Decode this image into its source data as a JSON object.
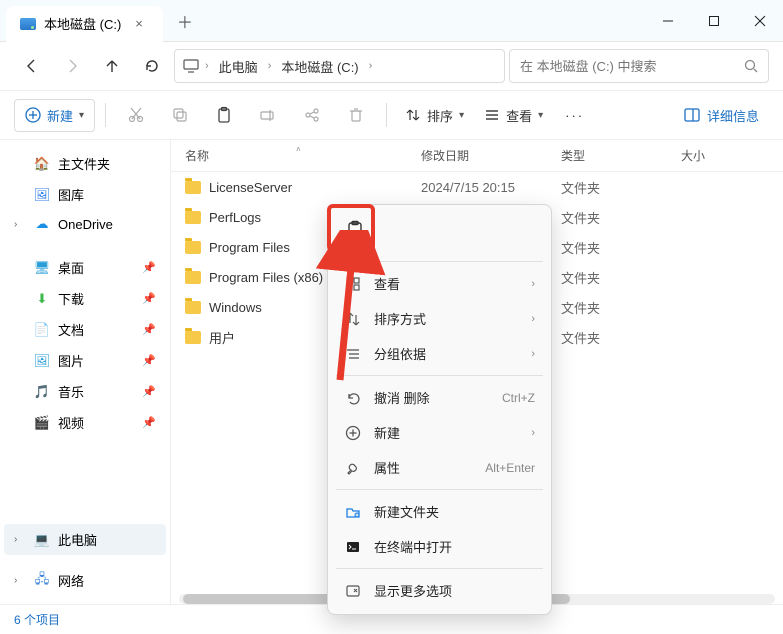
{
  "tab": {
    "title": "本地磁盘 (C:)"
  },
  "breadcrumbs": {
    "root_icon": "monitor",
    "items": [
      "此电脑",
      "本地磁盘 (C:)"
    ]
  },
  "search": {
    "placeholder": "在 本地磁盘 (C:) 中搜索"
  },
  "toolbar": {
    "new_label": "新建",
    "sort_label": "排序",
    "view_label": "查看",
    "details_label": "详细信息"
  },
  "sidebar": {
    "top": [
      {
        "label": "主文件夹",
        "icon": "home"
      },
      {
        "label": "图库",
        "icon": "gallery"
      },
      {
        "label": "OneDrive",
        "icon": "onedrive",
        "expandable": true
      }
    ],
    "quick": [
      {
        "label": "桌面",
        "icon": "desktop"
      },
      {
        "label": "下载",
        "icon": "download"
      },
      {
        "label": "文档",
        "icon": "docs"
      },
      {
        "label": "图片",
        "icon": "pics"
      },
      {
        "label": "音乐",
        "icon": "music"
      },
      {
        "label": "视频",
        "icon": "video"
      }
    ],
    "bottom": [
      {
        "label": "此电脑",
        "icon": "pc",
        "selected": true,
        "expandable": true
      },
      {
        "label": "网络",
        "icon": "net",
        "expandable": true
      }
    ]
  },
  "columns": {
    "name": "名称",
    "modified": "修改日期",
    "type": "类型",
    "size": "大小"
  },
  "files": [
    {
      "name": "LicenseServer",
      "modified": "2024/7/15 20:15",
      "type": "文件夹",
      "size": ""
    },
    {
      "name": "PerfLogs",
      "modified": "",
      "type": "文件夹",
      "size": ""
    },
    {
      "name": "Program Files",
      "modified": "",
      "type": "文件夹",
      "size": ""
    },
    {
      "name": "Program Files (x86)",
      "modified": "",
      "type": "文件夹",
      "size": ""
    },
    {
      "name": "Windows",
      "modified": "",
      "type": "文件夹",
      "size": ""
    },
    {
      "name": "用户",
      "modified": "",
      "type": "文件夹",
      "size": ""
    }
  ],
  "context_menu": {
    "view": "查看",
    "sort": "排序方式",
    "group": "分组依据",
    "undo": "撤消 删除",
    "undo_shortcut": "Ctrl+Z",
    "new": "新建",
    "properties": "属性",
    "properties_shortcut": "Alt+Enter",
    "new_folder": "新建文件夹",
    "terminal": "在终端中打开",
    "show_more": "显示更多选项"
  },
  "status": {
    "text": "6 个项目"
  }
}
